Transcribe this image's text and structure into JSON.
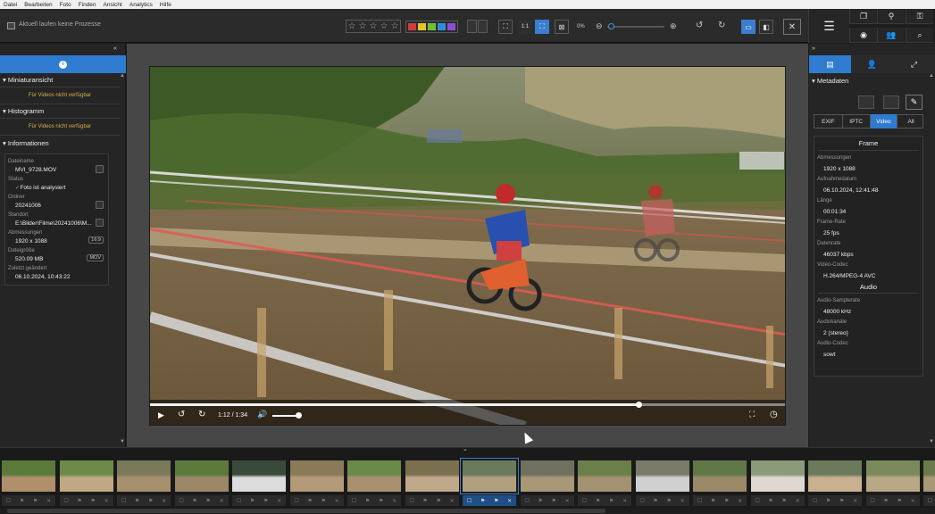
{
  "menu": [
    "Datei",
    "Bearbeiten",
    "Foto",
    "Finden",
    "Ansicht",
    "Analytics",
    "Hilfe"
  ],
  "toolbar": {
    "status_text": "Aktuell laufen keine Prozesse",
    "zoom_fit": "1:1",
    "zoom_percent": "0%",
    "color_labels": [
      "#d23b3b",
      "#e5c22c",
      "#6cc22f",
      "#2f8fd6",
      "#8a4fd6"
    ]
  },
  "left": {
    "sections": {
      "thumb": "Miniaturansicht",
      "hist": "Histogramm",
      "info": "Informationen"
    },
    "not_available": "Für Videos nicht verfügbar",
    "info": [
      {
        "label": "Dateiname",
        "value": "MVI_9728.MOV",
        "badge": "",
        "copy": true,
        "check": false
      },
      {
        "label": "Status",
        "value": "Foto ist analysiert",
        "badge": "",
        "copy": false,
        "check": true
      },
      {
        "label": "Ordner",
        "value": "20241006",
        "badge": "",
        "copy": true,
        "check": false
      },
      {
        "label": "Standort",
        "value": "E:\\Bilder\\Filme\\20241006\\M...",
        "badge": "",
        "copy": true,
        "check": false
      },
      {
        "label": "Abmessungen",
        "value": "1920 x 1088",
        "badge": "16:9",
        "copy": false,
        "check": false
      },
      {
        "label": "Dateigröße",
        "value": "520.09 MB",
        "badge": "MOV",
        "copy": false,
        "check": false
      },
      {
        "label": "Zuletzt geändert",
        "value": "06.10.2024, 10:43:22",
        "badge": "",
        "copy": false,
        "check": false
      }
    ]
  },
  "video": {
    "time": "1:12 / 1:34",
    "progress": 0.767,
    "volume": 0.95
  },
  "right": {
    "section": "Metadaten",
    "tabs": [
      "EXIF",
      "IPTC",
      "Video",
      "All"
    ],
    "active_tab": "Video",
    "frame_title": "Frame",
    "audio_title": "Audio",
    "frame": [
      {
        "label": "Abmessungen",
        "value": "1920 x 1088"
      },
      {
        "label": "Aufnahmedatum",
        "value": "06.10.2024, 12:41:48"
      },
      {
        "label": "Länge",
        "value": "00:01:34"
      },
      {
        "label": "Frame-Rate",
        "value": "25 fps"
      },
      {
        "label": "Datenrate",
        "value": "46037 kbps"
      },
      {
        "label": "Video-Codec",
        "value": "H.264/MPEG-4 AVC"
      }
    ],
    "audio": [
      {
        "label": "Audio-Samplerate",
        "value": "48000 kHz"
      },
      {
        "label": "Audiokanäle",
        "value": "2 (stereo)"
      },
      {
        "label": "Audio-Codec",
        "value": "sowt"
      }
    ]
  },
  "filmstrip": {
    "count": 17,
    "selected": 8
  }
}
